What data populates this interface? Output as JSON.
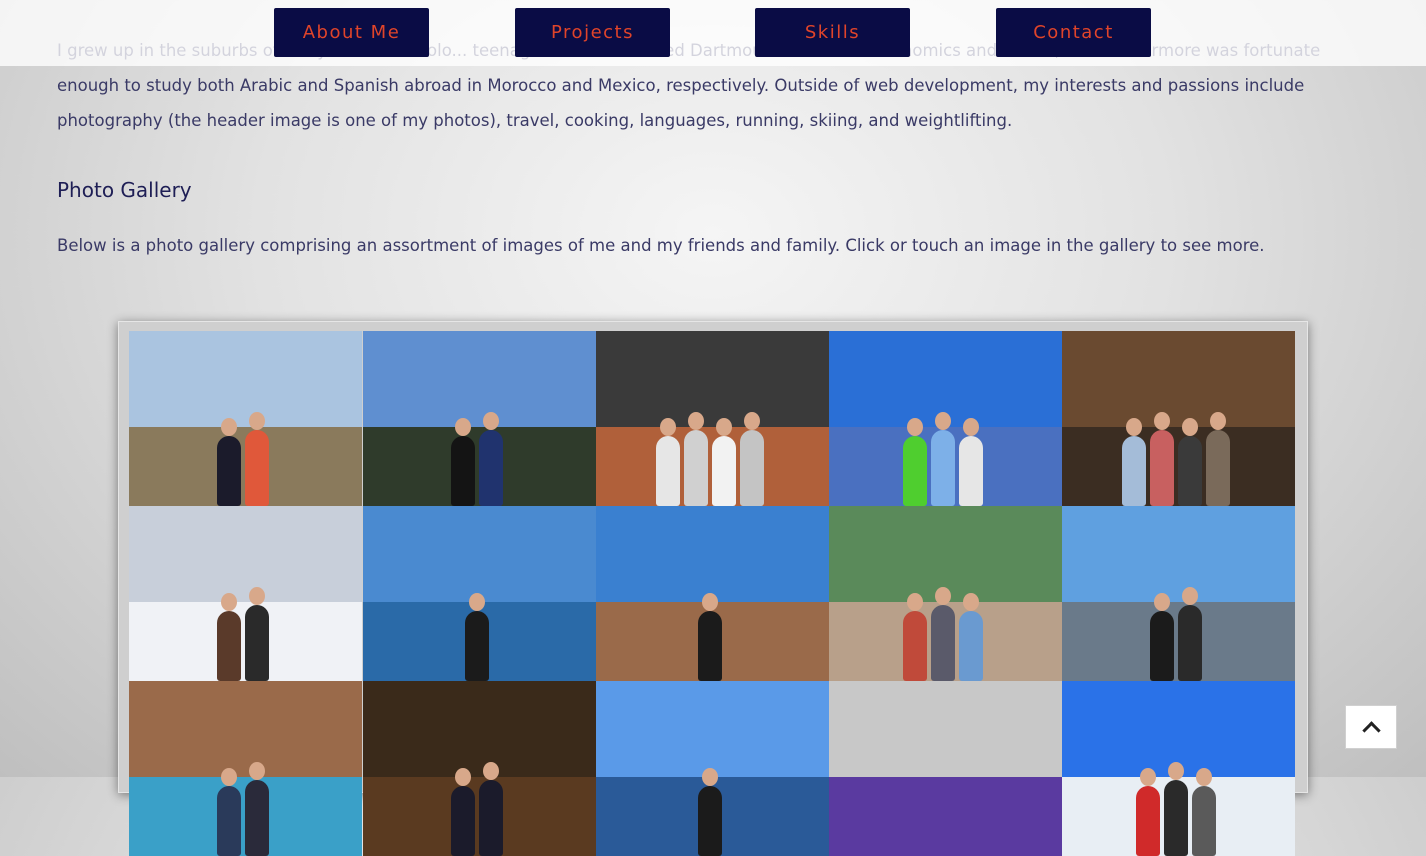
{
  "nav": {
    "items": [
      "About Me",
      "Projects",
      "Skills",
      "Contact"
    ]
  },
  "bio": {
    "text": "I grew up in the suburbs of N... y ...oved to Colo... teenager. At ... I attended Dartmouth ... studied Economics and Arabic, and furthermore was fortunate enough to study both Arabic and Spanish abroad in Morocco and Mexico, respectively. Outside of web development, my interests and passions include photography (the header image is one of my photos), travel, cooking, languages, running, skiing, and weightlifting."
  },
  "gallery": {
    "title": "Photo Gallery",
    "description": "Below is a photo gallery comprising an assortment of images of me and my friends and family. Click or touch an image in the gallery to see more.",
    "photos": [
      {
        "name": "coastal-cliff-couple-photo",
        "sky": "#aac4e0",
        "ground": "#8a7a5c",
        "figs": [
          "#1b1b2b",
          "#e0583a"
        ]
      },
      {
        "name": "mountain-ridge-friends-photo",
        "sky": "#5f8fd0",
        "ground": "#2f3b2b",
        "figs": [
          "#141414",
          "#20336e"
        ]
      },
      {
        "name": "race-finish-group-photo",
        "sky": "#3a3a3a",
        "ground": "#b0603a",
        "figs": [
          "#e6e6e6",
          "#d0d0d0",
          "#f2f2f2",
          "#c4c4c4"
        ]
      },
      {
        "name": "stadium-friends-photo",
        "sky": "#2a6fd6",
        "ground": "#4a70c0",
        "figs": [
          "#4fce2f",
          "#7db0e8",
          "#e6e6e6"
        ]
      },
      {
        "name": "winery-tasting-group-photo",
        "sky": "#6a4a30",
        "ground": "#3b2d22",
        "figs": [
          "#a4bcd8",
          "#c86060",
          "#3a3a3a",
          "#7a6a5a"
        ]
      },
      {
        "name": "snowy-ski-slope-photo",
        "sky": "#c8cfda",
        "ground": "#f0f2f6",
        "figs": [
          "#5a3a2a",
          "#2a2a2a"
        ]
      },
      {
        "name": "boat-lake-woman-photo",
        "sky": "#4a8ad0",
        "ground": "#2a6aa8",
        "figs": [
          "#1b1b1b"
        ]
      },
      {
        "name": "sailing-sunglasses-photo",
        "sky": "#3a80d0",
        "ground": "#9a6a4a",
        "figs": [
          "#1b1b1b"
        ]
      },
      {
        "name": "hilltop-wall-friends-photo",
        "sky": "#5a8a5a",
        "ground": "#b8a08a",
        "figs": [
          "#c04a3a",
          "#5a5a6a",
          "#6a9ad0"
        ]
      },
      {
        "name": "city-skyline-couple-photo",
        "sky": "#5fa0e0",
        "ground": "#6a7a8a",
        "figs": [
          "#1b1b1b",
          "#2a2a2a"
        ]
      },
      {
        "name": "villa-pool-friends-photo",
        "sky": "#9a6a4a",
        "ground": "#3aa0c8",
        "figs": [
          "#2a3a5a",
          "#2a2a3a"
        ]
      },
      {
        "name": "formal-event-friends-photo",
        "sky": "#3a2a1a",
        "ground": "#5a3a20",
        "figs": [
          "#1b1b2b",
          "#1b1b2b"
        ]
      },
      {
        "name": "beach-sky-man-photo",
        "sky": "#5a9ae8",
        "ground": "#2a5a98",
        "figs": [
          "#1b1b1b"
        ]
      },
      {
        "name": "presenter-speaking-photo",
        "sky": "#c8c8c8",
        "ground": "#5a3aa0",
        "figs": []
      },
      {
        "name": "ski-summit-group-photo",
        "sky": "#2a72e8",
        "ground": "#e8eef4",
        "figs": [
          "#d02a2a",
          "#2a2a2a",
          "#5a5a5a"
        ]
      }
    ]
  },
  "scroll_top": {
    "icon": "chevron-up-icon"
  }
}
